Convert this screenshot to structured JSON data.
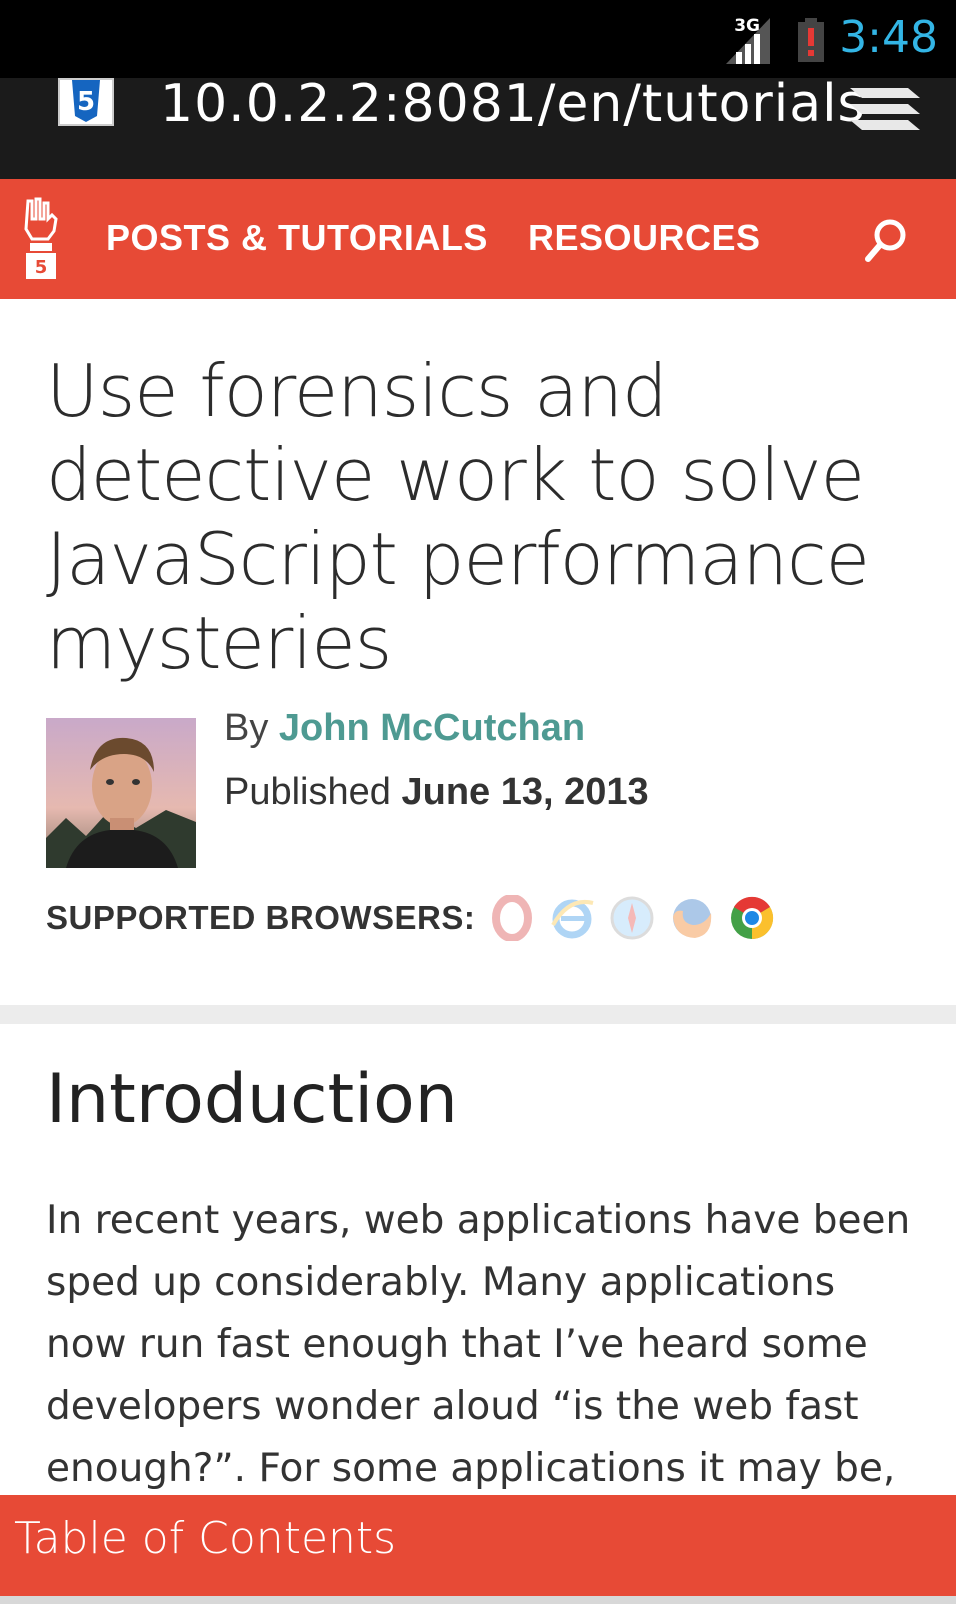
{
  "status_bar": {
    "network": "3G",
    "time": "3:48"
  },
  "browser": {
    "url": "10.0.2.2:8081/en/tutorials",
    "favicon": "html5-icon",
    "menu_icon": "stack-menu-icon"
  },
  "nav": {
    "logo": "html5-rocks-logo",
    "items": [
      {
        "label": "POSTS & TUTORIALS"
      },
      {
        "label": "RESOURCES"
      }
    ],
    "search_icon": "search-icon",
    "color": "#e74a36"
  },
  "article": {
    "title": "Use forensics and detective work to solve JavaScript performance mysteries",
    "by_prefix": "By",
    "author": "John McCutchan",
    "published_prefix": "Published",
    "date": "June 13, 2013",
    "supported_label": "SUPPORTED BROWSERS:",
    "browsers": [
      "opera-icon",
      "ie-icon",
      "safari-icon",
      "firefox-icon",
      "chrome-icon"
    ],
    "author_color": "#4e9a92"
  },
  "intro": {
    "heading": "Introduction",
    "paragraph": "In recent years, web applications have been sped up considerably. Many applications now run fast enough that I’ve heard some developers wonder aloud “is the web fast enough?”. For some applications it may be,"
  },
  "toc": {
    "label": "Table of Contents"
  }
}
